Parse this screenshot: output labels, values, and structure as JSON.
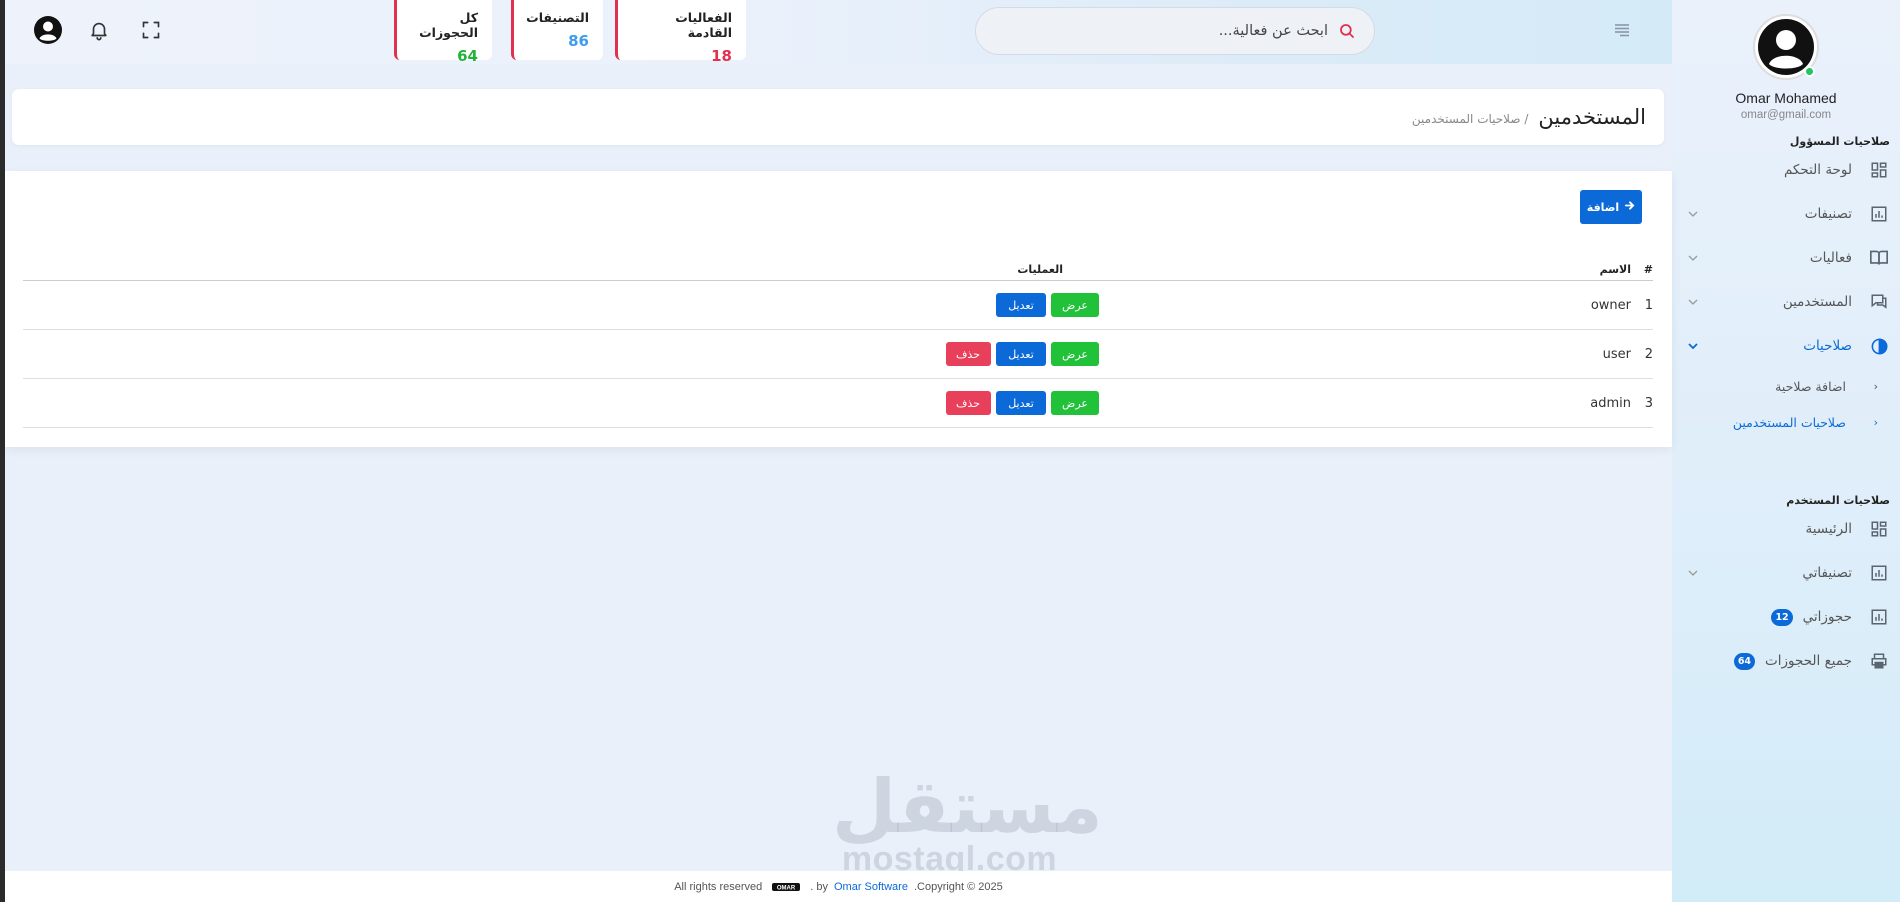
{
  "sidebar": {
    "user_name": "Omar Mohamed",
    "user_email": "omar@gmail.com",
    "admin_section_title": "صلاحيات المسؤول",
    "user_section_title": "صلاحيات المستخدم",
    "admin_items": [
      {
        "label": "لوحة التحكم",
        "icon": "dashboard-icon"
      },
      {
        "label": "تصنيفات",
        "icon": "chart-icon"
      },
      {
        "label": "فعاليات",
        "icon": "book-icon"
      },
      {
        "label": "المستخدمين",
        "icon": "chat-icon"
      },
      {
        "label": "صلاحيات",
        "icon": "globe-icon"
      }
    ],
    "permissions_submenu": [
      {
        "label": "اضافة صلاحية"
      },
      {
        "label": "صلاحيات المستخدمين"
      }
    ],
    "user_items": [
      {
        "label": "الرئيسية",
        "icon": "dashboard-icon"
      },
      {
        "label": "تصنيفاتي",
        "icon": "chart-icon"
      },
      {
        "label": "حجوزاتي",
        "icon": "chart-icon",
        "badge": "12"
      },
      {
        "label": "جميع الحجوزات",
        "icon": "printer-icon",
        "badge": "64"
      }
    ]
  },
  "header": {
    "search_placeholder": "ابحث عن فعالية...",
    "stats": [
      {
        "label": "الفعاليات القادمة",
        "value": "18",
        "color": "#e1314f"
      },
      {
        "label": "التصنيفات",
        "value": "86",
        "color": "#3d9bf0"
      },
      {
        "label": "كل الحجوزات",
        "value": "64",
        "color": "#22b33a"
      }
    ]
  },
  "page": {
    "title": "المستخدمين",
    "breadcrumb": "/ صلاحيات المستخدمين"
  },
  "content": {
    "add_button_label": "اضافة",
    "table": {
      "headers": {
        "index": "#",
        "name": "الاسم",
        "operations": "العمليات"
      },
      "view_label": "عرض",
      "edit_label": "تعديل",
      "delete_label": "حذف",
      "rows": [
        {
          "index": "1",
          "name": "owner"
        },
        {
          "index": "2",
          "name": "user"
        },
        {
          "index": "3",
          "name": "admin"
        }
      ]
    }
  },
  "watermark": {
    "arabic": "مستقل",
    "latin": "mostaql.com"
  },
  "footer": {
    "copyright": ".Copyright © 2025",
    "brand": "Omar Software",
    "by": ". by",
    "rights": "All rights reserved"
  }
}
